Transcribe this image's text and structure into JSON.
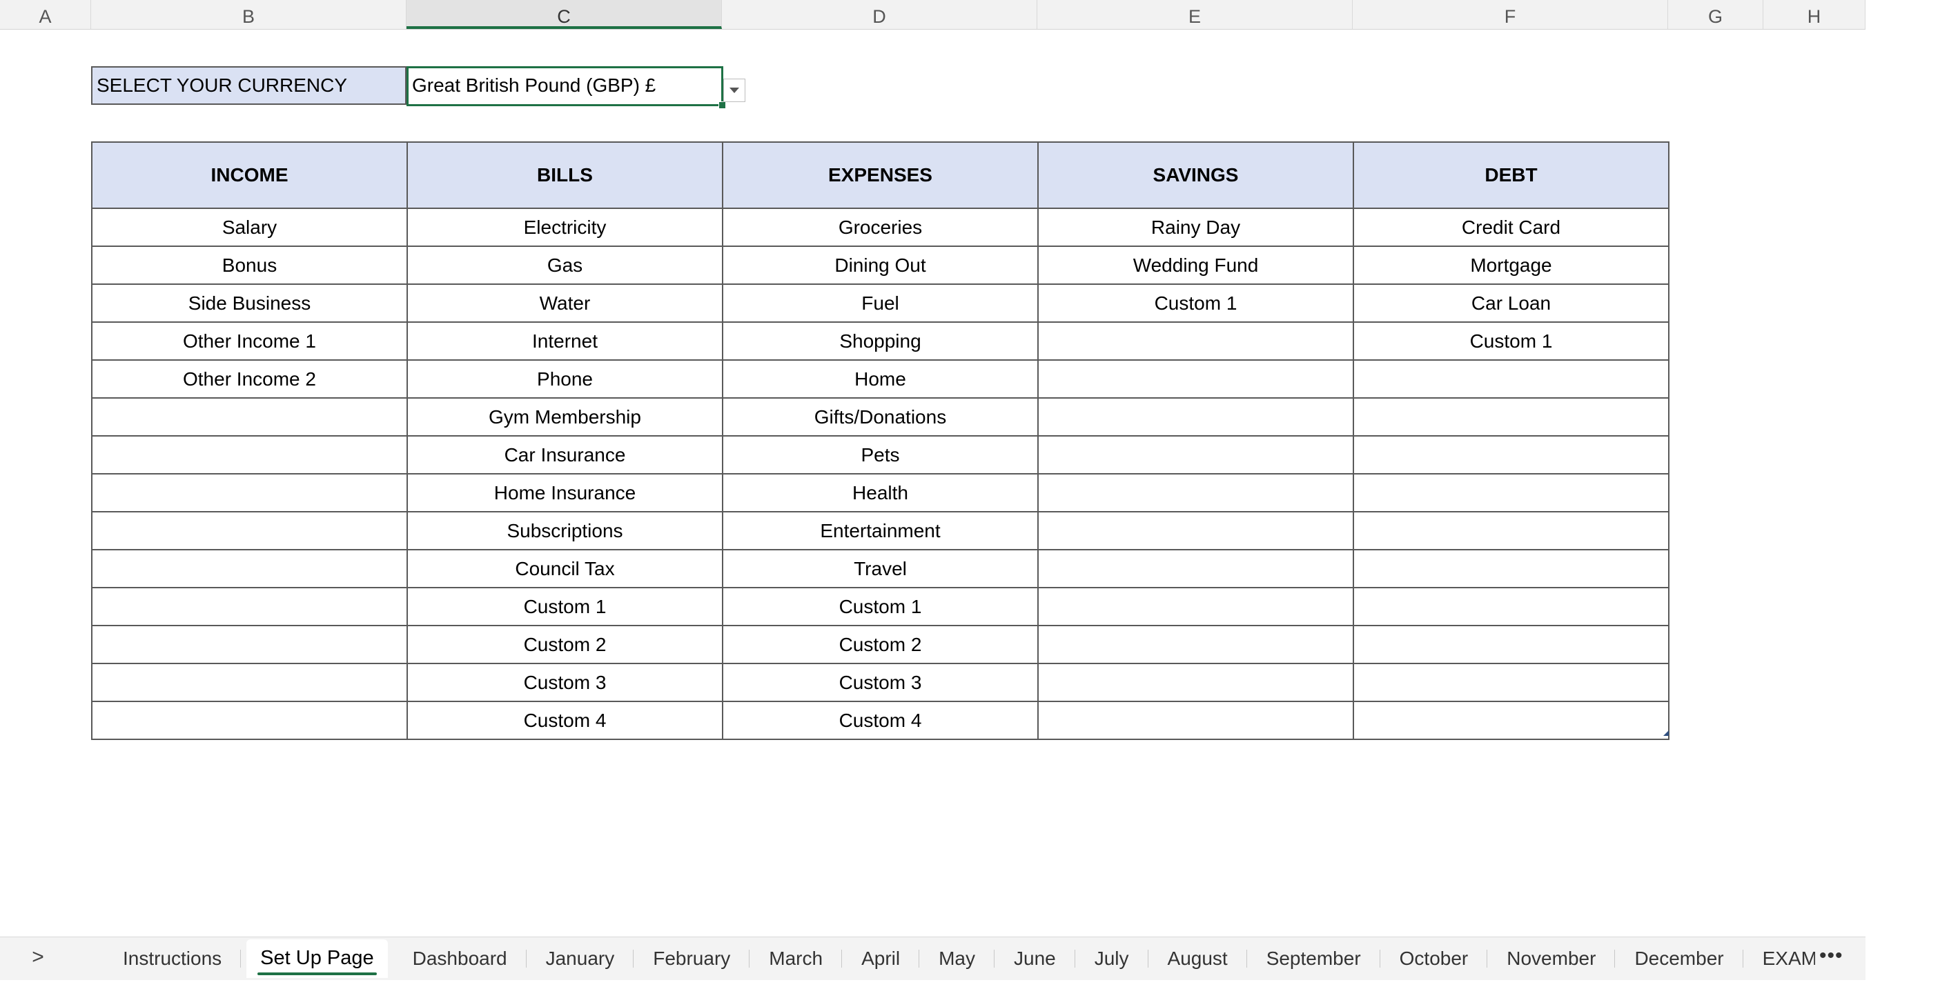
{
  "columns": [
    "A",
    "B",
    "C",
    "D",
    "E",
    "F",
    "G",
    "H"
  ],
  "currency": {
    "label": "SELECT YOUR CURRENCY",
    "value": "Great British Pound (GBP) £"
  },
  "table": {
    "headers": [
      "INCOME",
      "BILLS",
      "EXPENSES",
      "SAVINGS",
      "DEBT"
    ],
    "rows": [
      [
        "Salary",
        "Electricity",
        "Groceries",
        "Rainy Day",
        "Credit Card"
      ],
      [
        "Bonus",
        "Gas",
        "Dining Out",
        "Wedding Fund",
        "Mortgage"
      ],
      [
        "Side Business",
        "Water",
        "Fuel",
        "Custom 1",
        "Car Loan"
      ],
      [
        "Other Income 1",
        "Internet",
        "Shopping",
        "",
        "Custom 1"
      ],
      [
        "Other Income 2",
        "Phone",
        "Home",
        "",
        ""
      ],
      [
        "",
        "Gym Membership",
        "Gifts/Donations",
        "",
        ""
      ],
      [
        "",
        "Car Insurance",
        "Pets",
        "",
        ""
      ],
      [
        "",
        "Home Insurance",
        "Health",
        "",
        ""
      ],
      [
        "",
        "Subscriptions",
        "Entertainment",
        "",
        ""
      ],
      [
        "",
        "Council Tax",
        "Travel",
        "",
        ""
      ],
      [
        "",
        "Custom 1",
        "Custom 1",
        "",
        ""
      ],
      [
        "",
        "Custom 2",
        "Custom 2",
        "",
        ""
      ],
      [
        "",
        "Custom 3",
        "Custom 3",
        "",
        ""
      ],
      [
        "",
        "Custom 4",
        "Custom 4",
        "",
        ""
      ]
    ]
  },
  "tabs": {
    "nav_arrow": ">",
    "items": [
      "Instructions",
      "Set Up Page",
      "Dashboard",
      "January",
      "February",
      "March",
      "April",
      "May",
      "June",
      "July",
      "August",
      "September",
      "October",
      "November",
      "December",
      "EXAMPLE"
    ],
    "active": "Set Up Page",
    "more": "•••"
  },
  "colors": {
    "accent_green": "#1e7145",
    "header_fill": "#dae1f3"
  }
}
